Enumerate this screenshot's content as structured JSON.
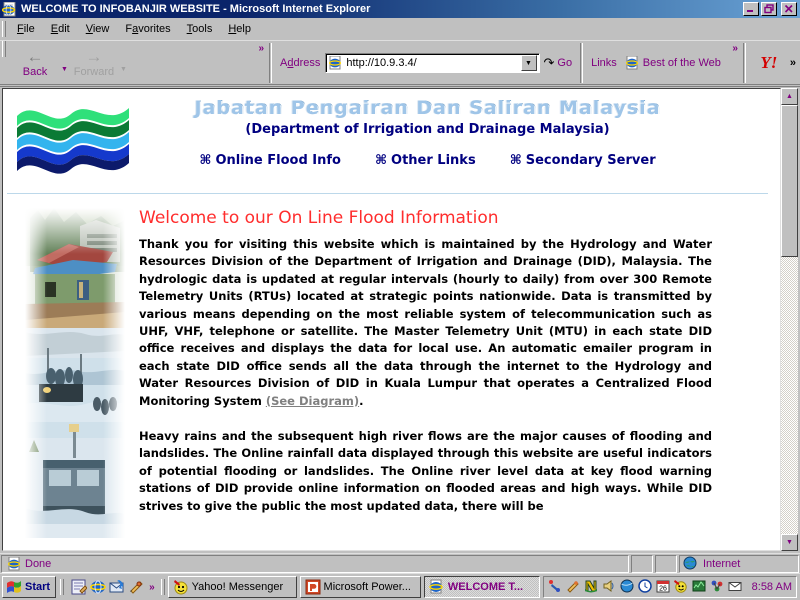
{
  "window": {
    "title": "WELCOME TO INFOBANJIR WEBSITE - Microsoft Internet Explorer",
    "icon": "ie-document-icon",
    "minimize_label": "_",
    "restore_label": "❐",
    "close_label": "×"
  },
  "menubar": {
    "items": [
      {
        "label": "File",
        "accel": "F"
      },
      {
        "label": "Edit",
        "accel": "E"
      },
      {
        "label": "View",
        "accel": "V"
      },
      {
        "label": "Favorites",
        "accel": "a"
      },
      {
        "label": "Tools",
        "accel": "T"
      },
      {
        "label": "Help",
        "accel": "H"
      }
    ]
  },
  "toolbar": {
    "back_label": "Back",
    "forward_label": "Forward",
    "overflow_label": "»",
    "address_label": "Address",
    "address_value": "http://10.9.3.4/",
    "address_icon": "ie-page-icon",
    "dropdown_glyph": "▼",
    "go_label": "Go",
    "go_glyph": "↷",
    "links_label": "Links",
    "link_items": [
      {
        "label": "Best of the Web",
        "icon": "ie-page-icon"
      }
    ],
    "yahoo_label": "Y!",
    "tail_overflow": "»"
  },
  "page": {
    "logo_name": "jps-wave-logo",
    "site_title": "Jabatan Pengairan Dan Saliran Malaysia",
    "site_subtitle": "(Department of Irrigation and Drainage Malaysia)",
    "nav": [
      {
        "bullet": "⌘",
        "label": "Online Flood Info"
      },
      {
        "bullet": "⌘",
        "label": "Other Links"
      },
      {
        "bullet": "⌘",
        "label": "Secondary Server"
      }
    ],
    "photo_name": "flood-damage-photo-collage",
    "heading": "Welcome to our On Line Flood Information",
    "paragraph1_before": "Thank you for visiting this website which is maintained by the Hydrology and Water Resources Division of the Department of Irrigation and Drainage (DID), Malaysia. The hydrologic data is updated at regular intervals (hourly to daily) from over 300 Remote Telemetry Units (RTUs) located at strategic points nationwide. Data is transmitted by various means depending on the most reliable system of telecommunication such as UHF, VHF, telephone or satellite. The Master Telemetry Unit (MTU) in each state DID office receives and displays the data for local use.  An automatic emailer program in each state DID office sends all the data through the internet to the Hydrology and Water Resources Division of DID in Kuala Lumpur that operates a Centralized Flood Monitoring System ",
    "paragraph1_link": "(See Diagram)",
    "paragraph1_after": ".",
    "paragraph2": "Heavy rains and the subsequent high river flows are the major causes of flooding and landslides.   The Online rainfall data displayed through this website are useful indicators of potential flooding or landslides.  The Online river level data at key flood warning stations of DID provide online information on flooded areas and high ways.  While DID strives to give the public the most updated data, there will be"
  },
  "scrollbar": {
    "up_glyph": "▲",
    "down_glyph": "▼"
  },
  "statusbar": {
    "status_text": "Done",
    "status_icon": "ie-page-icon",
    "zone_label": "Internet",
    "zone_icon": "globe-icon"
  },
  "taskbar": {
    "start_label": "Start",
    "start_icon": "windows-flag-icon",
    "quicklaunch": [
      {
        "name": "show-desktop-icon"
      },
      {
        "name": "internet-explorer-icon"
      },
      {
        "name": "outlook-express-icon"
      },
      {
        "name": "launch-media-icon"
      }
    ],
    "quicklaunch_overflow": "»",
    "tasks": [
      {
        "label": "Yahoo! Messenger",
        "icon": "yahoo-messenger-icon",
        "active": false
      },
      {
        "label": "Microsoft Power...",
        "icon": "powerpoint-icon",
        "active": false
      },
      {
        "label": "WELCOME T...",
        "icon": "internet-explorer-icon",
        "active": true
      }
    ],
    "tray_icons": [
      {
        "name": "pointer-device-icon"
      },
      {
        "name": "launch-media-icon"
      },
      {
        "name": "norton-antivirus-icon"
      },
      {
        "name": "volume-icon"
      },
      {
        "name": "display-icon"
      },
      {
        "name": "clock-sync-icon"
      },
      {
        "name": "calendar-icon"
      },
      {
        "name": "yahoo-messenger-icon"
      },
      {
        "name": "network-monitor-icon"
      },
      {
        "name": "network-connection-icon"
      },
      {
        "name": "mail-icon"
      }
    ],
    "clock": "8:58 AM"
  },
  "colors": {
    "title_bar_start": "#0a246a",
    "title_bar_end": "#6ba3d6",
    "face": "#c0c0c0",
    "heading_red": "#ff2d2d",
    "navy": "#000080",
    "site_title_blue": "#9fc5e8",
    "link_purple": "#800080",
    "rule_blue": "#bcd8ea"
  }
}
